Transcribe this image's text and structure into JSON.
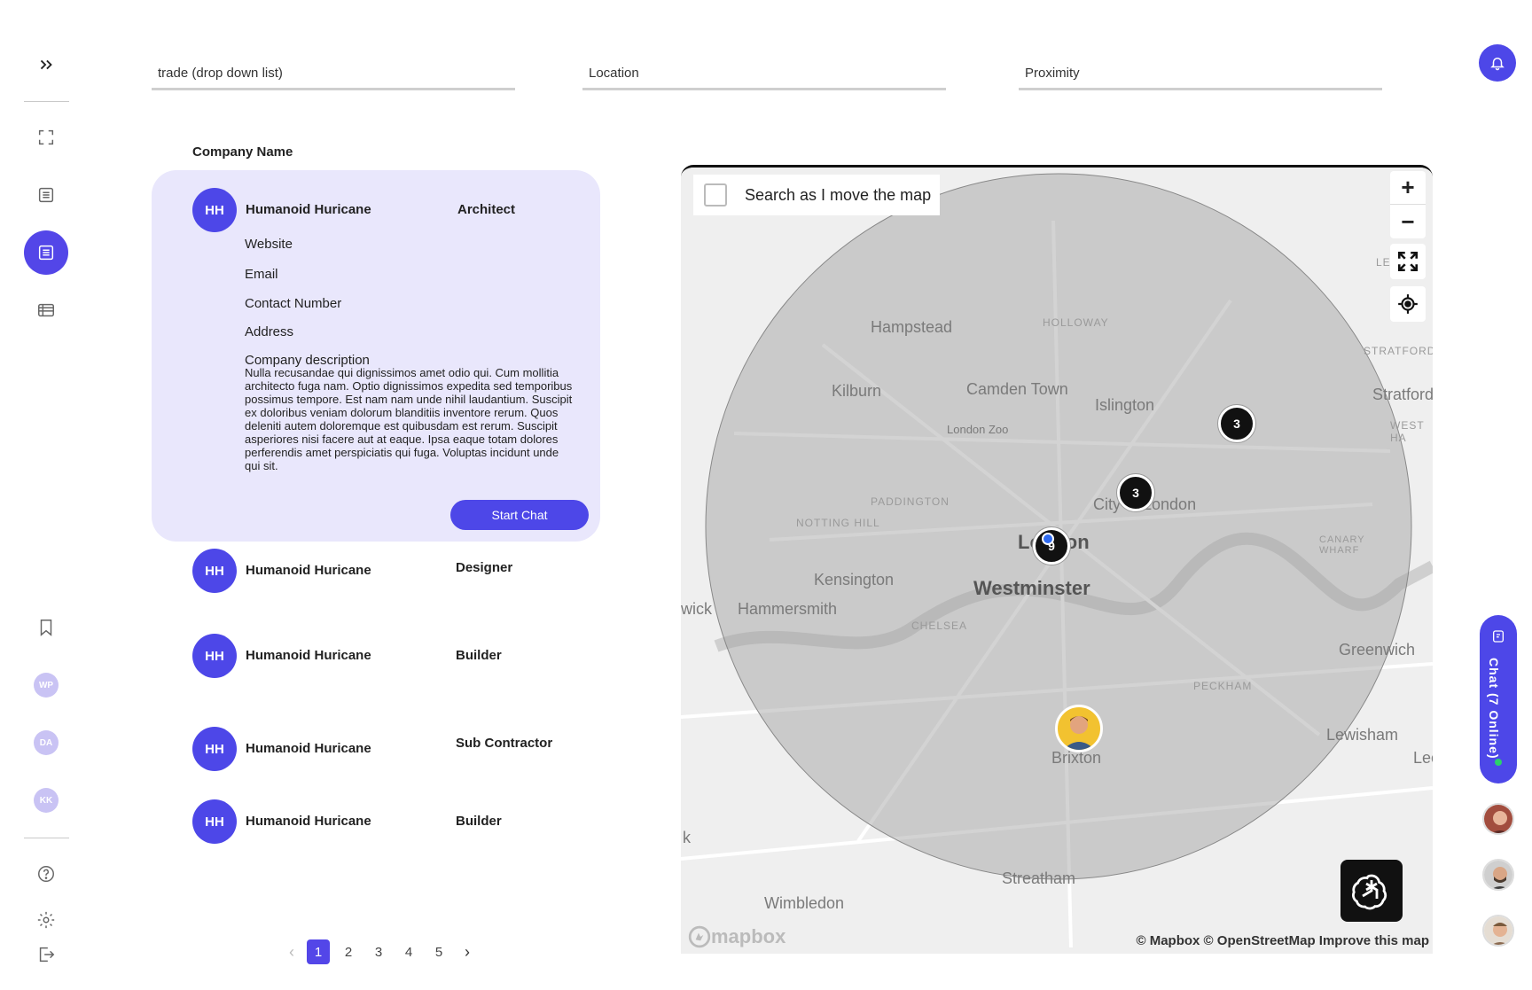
{
  "filters": {
    "trade": "trade (drop down list)",
    "location": "Location",
    "proximity": "Proximity"
  },
  "list": {
    "column_header": "Company Name",
    "selected": {
      "initials": "HH",
      "name": "Humanoid Huricane",
      "role": "Architect",
      "fields": [
        "Website",
        "Email",
        "Contact Number",
        "Address"
      ],
      "description_title": "Company description",
      "description": "Nulla recusandae qui dignissimos amet odio qui. Cum mollitia architecto fuga nam. Optio dignissimos expedita sed temporibus possimus tempore. Est nam nam unde nihil laudantium. Suscipit ex doloribus veniam dolorum blanditiis inventore rerum. Quos deleniti autem doloremque est quibusdam est rerum. Suscipit asperiores nisi facere aut at eaque. Ipsa eaque totam dolores perferendis amet perspiciatis qui fuga. Voluptas incidunt unde qui sit.",
      "action": "Start Chat"
    },
    "rows": [
      {
        "initials": "HH",
        "name": "Humanoid Huricane",
        "role": "Designer"
      },
      {
        "initials": "HH",
        "name": "Humanoid Huricane",
        "role": "Builder"
      },
      {
        "initials": "HH",
        "name": "Humanoid Huricane",
        "role": "Sub Contractor"
      },
      {
        "initials": "HH",
        "name": "Humanoid Huricane",
        "role": "Builder"
      }
    ]
  },
  "pagination": {
    "pages": [
      "1",
      "2",
      "3",
      "4",
      "5"
    ],
    "current": "1",
    "prev_icon": "chevron-left-icon",
    "next_icon": "chevron-right-icon"
  },
  "map": {
    "search_label": "Search as I move the map",
    "zoom_in": "+",
    "zoom_out": "−",
    "clusters": [
      "3",
      "3",
      "9"
    ],
    "labels": {
      "hampstead": "Hampstead",
      "holloway": "HOLLOWAY",
      "stratford_sm": "STRATFORD",
      "kilburn": "Kilburn",
      "camden": "Camden Town",
      "islington": "Islington",
      "stratford": "Stratford",
      "london_zoo": "London Zoo",
      "west_ham": "WEST HA",
      "paddington": "PADDINGTON",
      "city": "City of London",
      "notting_hill": "NOTTING HILL",
      "london": "London",
      "canary": "CANARY WHARF",
      "kensington": "Kensington",
      "westminster": "Westminster",
      "hammersmith": "Hammersmith",
      "chiswick": "wick",
      "chelsea": "CHELSEA",
      "greenwich": "Greenwich",
      "peckham": "PECKHAM",
      "lewisham": "Lewisham",
      "lee": "Lee",
      "brixton": "Brixton",
      "streatham": "Streatham",
      "wimbledon": "Wimbledon",
      "k": "k",
      "ley": "LEY"
    },
    "attribution": "© Mapbox © OpenStreetMap  Improve this map",
    "logo": "mapbox"
  },
  "sidebar": {
    "avatars": [
      "WP",
      "DA",
      "KK"
    ]
  },
  "chat": {
    "label": "Chat (7 Online)"
  },
  "colors": {
    "accent": "#4d47e8",
    "card_bg": "#e9e7fc",
    "online": "#2ad16b"
  }
}
